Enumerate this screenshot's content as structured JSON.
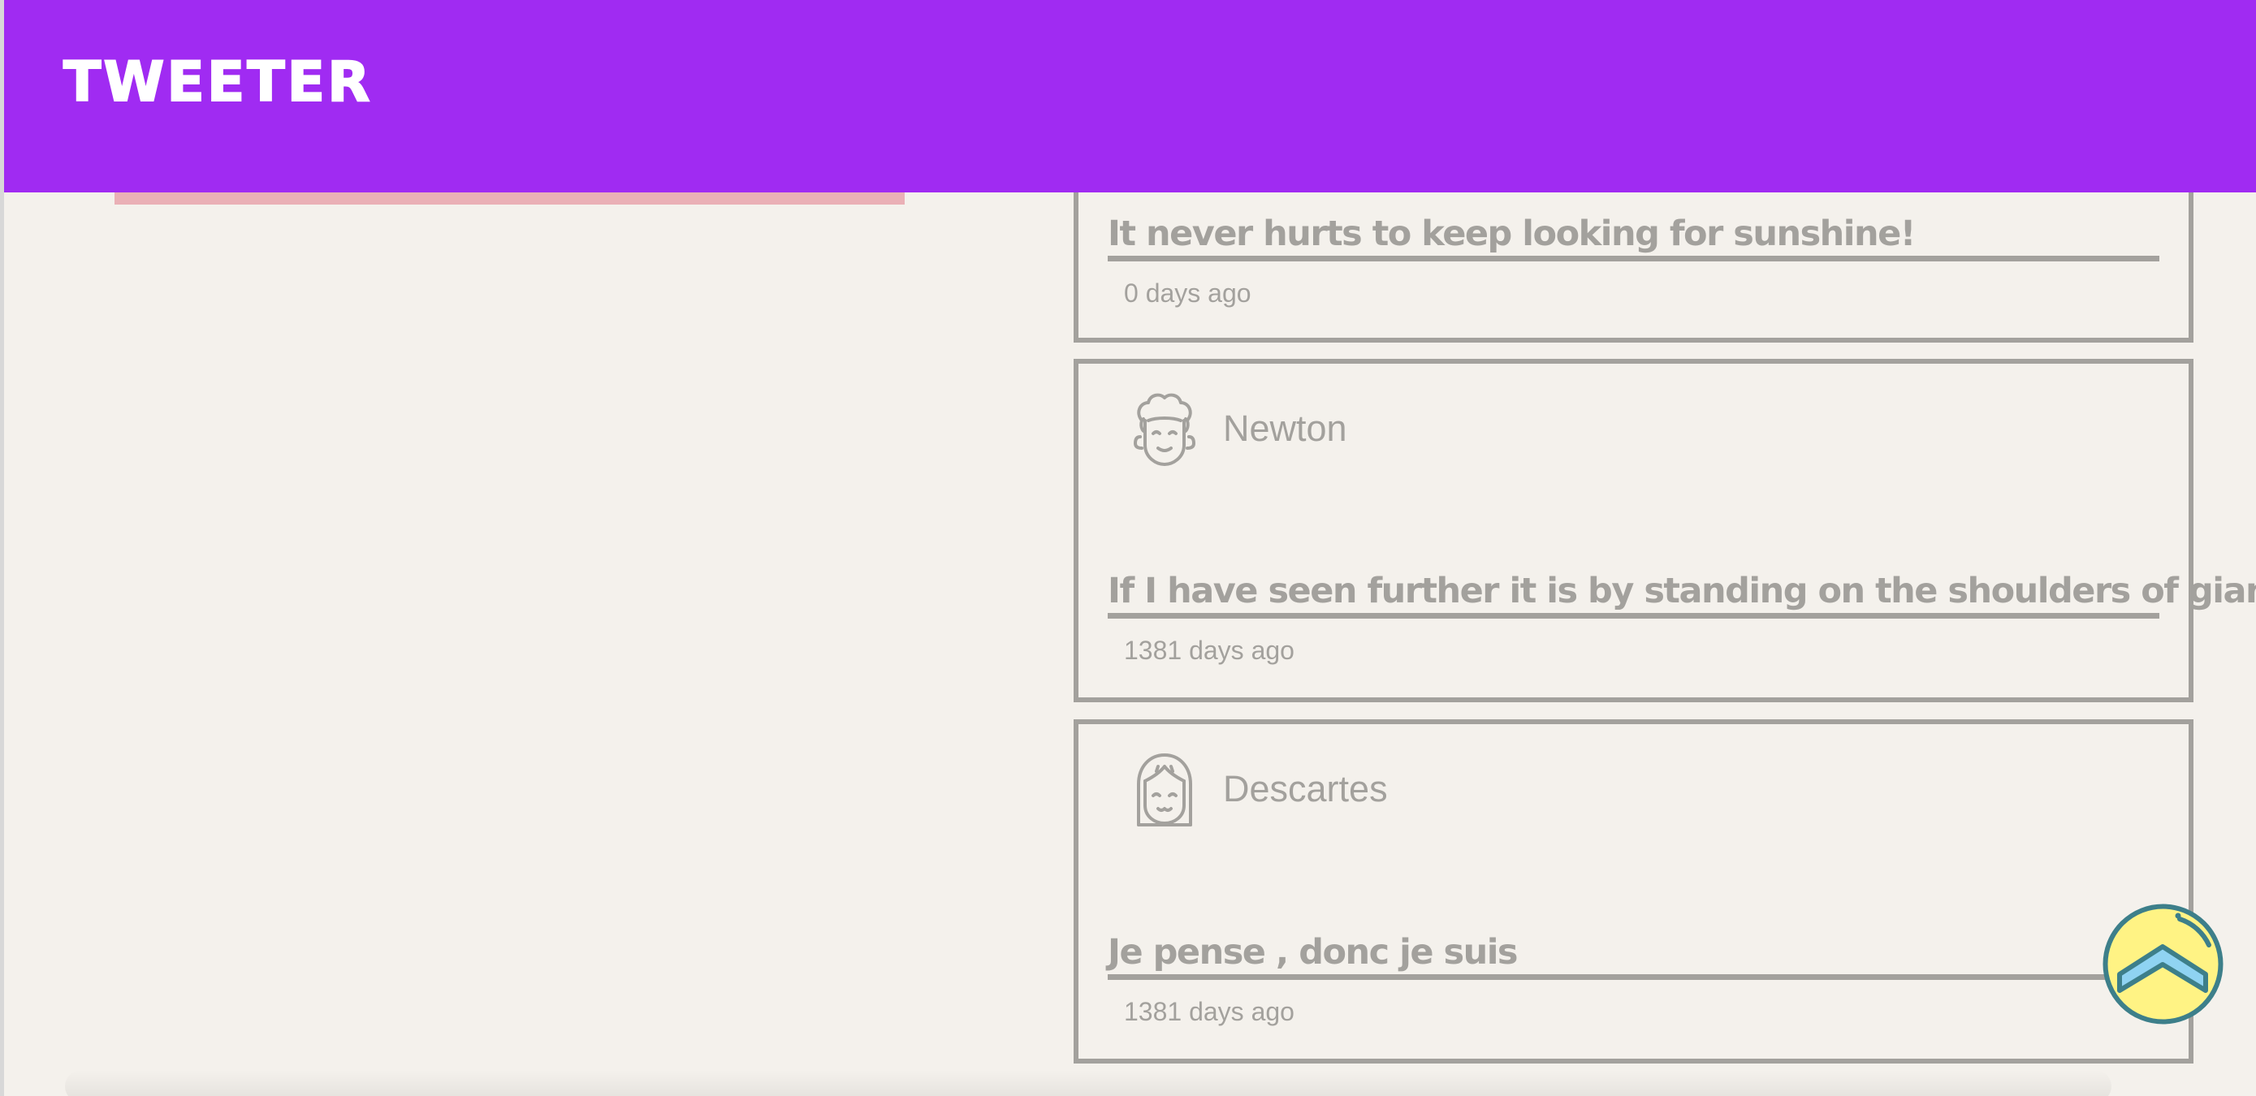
{
  "navbar": {
    "brand": "TWEETER",
    "background_color": "#a02bf2"
  },
  "tweets": [
    {
      "author": "",
      "text": "It never hurts to keep looking for sunshine!",
      "time": "0 days ago"
    },
    {
      "author": "Newton",
      "avatar_icon": "curly-hair-face-icon",
      "text": "If I have seen further it is by standing on the shoulders of giants",
      "time": "1381 days ago"
    },
    {
      "author": "Descartes",
      "avatar_icon": "bob-hair-face-icon",
      "text": "Je pense , donc je suis",
      "time": "1381 days ago"
    }
  ],
  "scroll_to_top": {
    "icon": "chevron-up-icon",
    "fill_color": "#fff384",
    "arrow_color": "#8fd3f2",
    "stroke_color": "#3d7f8a"
  },
  "colors": {
    "page_background": "#f4f1ec",
    "tweet_border": "#a3a19d",
    "text_muted": "#a3a19d",
    "accent_pink": "#e8a4ad"
  }
}
